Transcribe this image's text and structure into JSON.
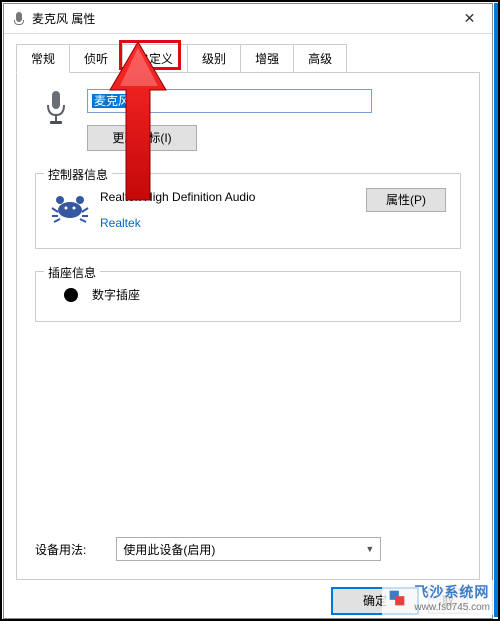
{
  "window": {
    "title": "麦克风 属性"
  },
  "tabs": [
    {
      "label": "常规"
    },
    {
      "label": "侦听"
    },
    {
      "label": "自定义"
    },
    {
      "label": "级别"
    },
    {
      "label": "增强"
    },
    {
      "label": "高级"
    }
  ],
  "device": {
    "name": "麦克风",
    "change_icon_label": "更改图标(I)"
  },
  "controller": {
    "legend": "控制器信息",
    "name": "Realtek High Definition Audio",
    "vendor": "Realtek",
    "properties_label": "属性(P)"
  },
  "jack": {
    "legend": "插座信息",
    "name": "数字插座"
  },
  "usage": {
    "label": "设备用法:",
    "selected": "使用此设备(启用)"
  },
  "buttons": {
    "ok": "确定",
    "cancel": "取"
  },
  "watermark": {
    "name": "飞沙系统网",
    "url": "www.fs0745.com"
  }
}
